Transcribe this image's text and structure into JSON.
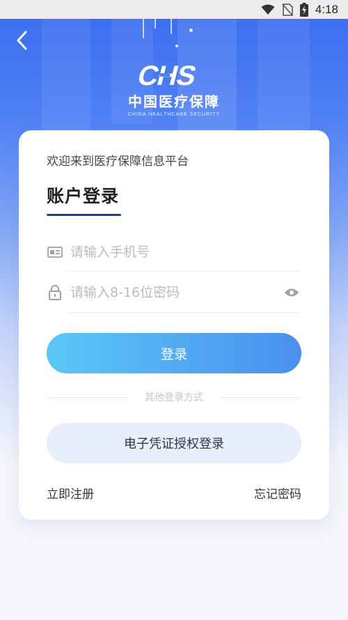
{
  "status_bar": {
    "time": "4:18",
    "icons": [
      "wifi-icon",
      "no-sim-icon",
      "battery-charging-icon"
    ]
  },
  "header": {
    "back_icon": "chevron-left-icon",
    "logo_cn": "中国医疗保障",
    "logo_en": "CHINA HEALTHCARE SECURITY"
  },
  "login": {
    "welcome": "欢迎来到医疗保障信息平台",
    "title": "账户登录",
    "phone_placeholder": "请输入手机号",
    "password_placeholder": "请输入8-16位密码",
    "login_label": "登录",
    "other_methods": "其他登录方式",
    "ecert_label": "电子凭证授权登录",
    "register_label": "立即注册",
    "forgot_label": "忘记密码"
  },
  "colors": {
    "hero_top": "#3d6ff0",
    "button_start": "#5bc8f7",
    "button_end": "#4a8fee",
    "underline": "#1f3f9a",
    "secondary_button": "#e9eefb"
  }
}
